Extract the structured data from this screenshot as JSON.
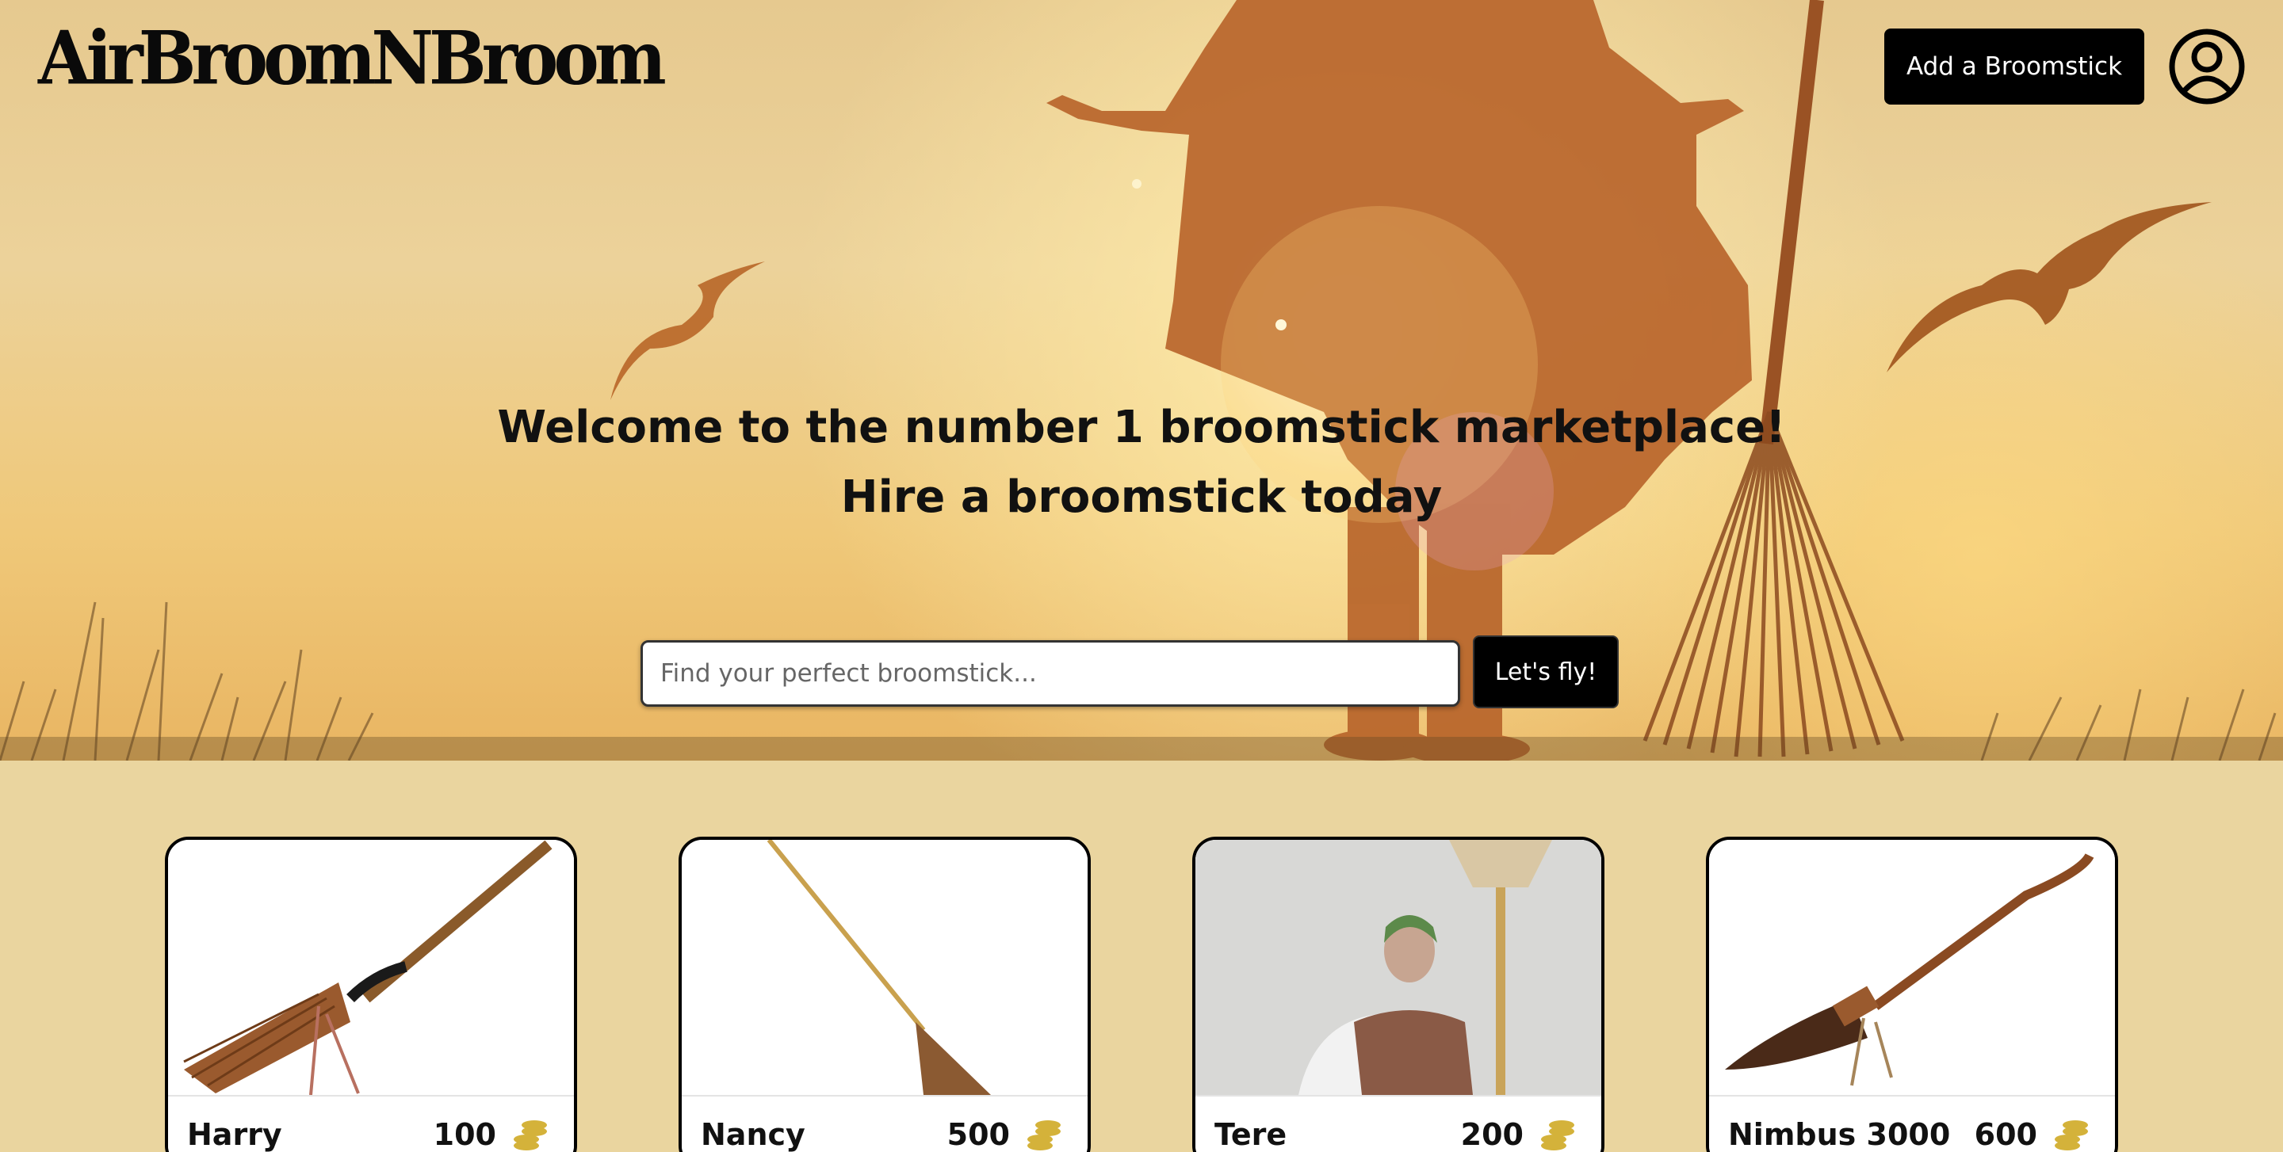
{
  "app": {
    "logo_text": "AirBroomNBroom"
  },
  "header": {
    "add_button_label": "Add a Broomstick",
    "user_icon": "user-circle-icon"
  },
  "hero": {
    "title_line1": "Welcome to the number 1 broomstick marketplace!",
    "title_line2": "Hire a broomstick today",
    "search_placeholder": "Find your perfect broomstick...",
    "search_button_label": "Let's fly!"
  },
  "listings": [
    {
      "name": "Harry",
      "price": "100",
      "currency_icon": "coins-icon"
    },
    {
      "name": "Nancy",
      "price": "500",
      "currency_icon": "coins-icon"
    },
    {
      "name": "Tere",
      "price": "200",
      "currency_icon": "coins-icon"
    },
    {
      "name": "Nimbus 3000",
      "price": "600",
      "currency_icon": "coins-icon"
    }
  ],
  "colors": {
    "page_background": "#ead59f",
    "button_background": "#000000",
    "coin_gold": "#d4b23a",
    "silhouette": "#b8662a"
  }
}
